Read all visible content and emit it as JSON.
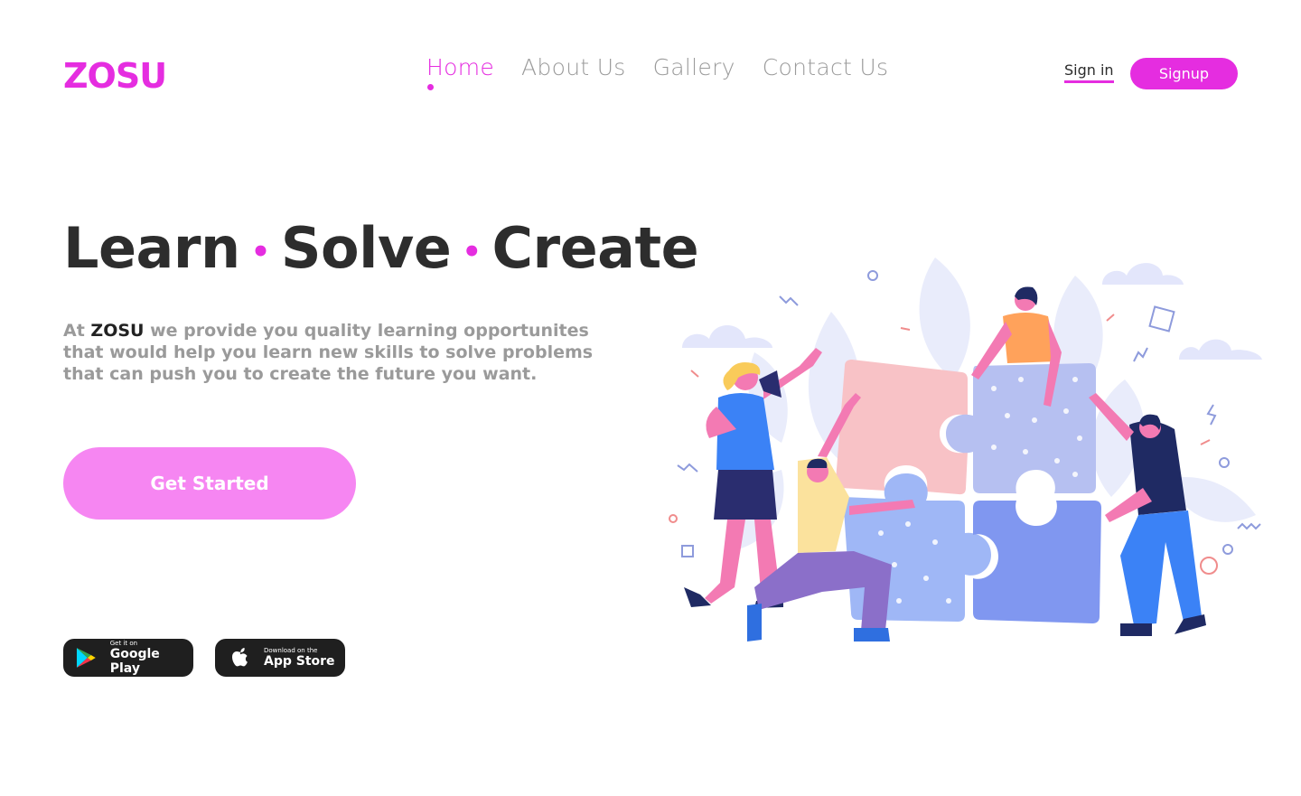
{
  "brand": {
    "name": "ZOSU",
    "color": "#e52de0"
  },
  "nav": {
    "items": [
      {
        "label": "Home",
        "active": true
      },
      {
        "label": "About Us",
        "active": false
      },
      {
        "label": "Gallery",
        "active": false
      },
      {
        "label": "Contact Us",
        "active": false
      }
    ]
  },
  "auth": {
    "signin_label": "Sign in",
    "signup_label": "Signup"
  },
  "hero": {
    "title_words": [
      "Learn",
      "Solve",
      "Create"
    ],
    "title_separator": "•",
    "desc_prefix": "At",
    "desc_brand": "ZOSU",
    "desc_rest": "we provide you quality learning opportunites that would help you learn new skills to solve problems that can push you to create the future you want.",
    "cta_label": "Get Started"
  },
  "stores": {
    "google": {
      "small": "Get it on",
      "big": "Google Play",
      "icon": "google-play-icon"
    },
    "apple": {
      "small": "Download on the",
      "big": "App Store",
      "icon": "apple-icon"
    }
  },
  "colors": {
    "accent": "#e52de0",
    "cta": "#f686f2",
    "text": "#2d2d2d",
    "muted": "#9a9a9a"
  }
}
